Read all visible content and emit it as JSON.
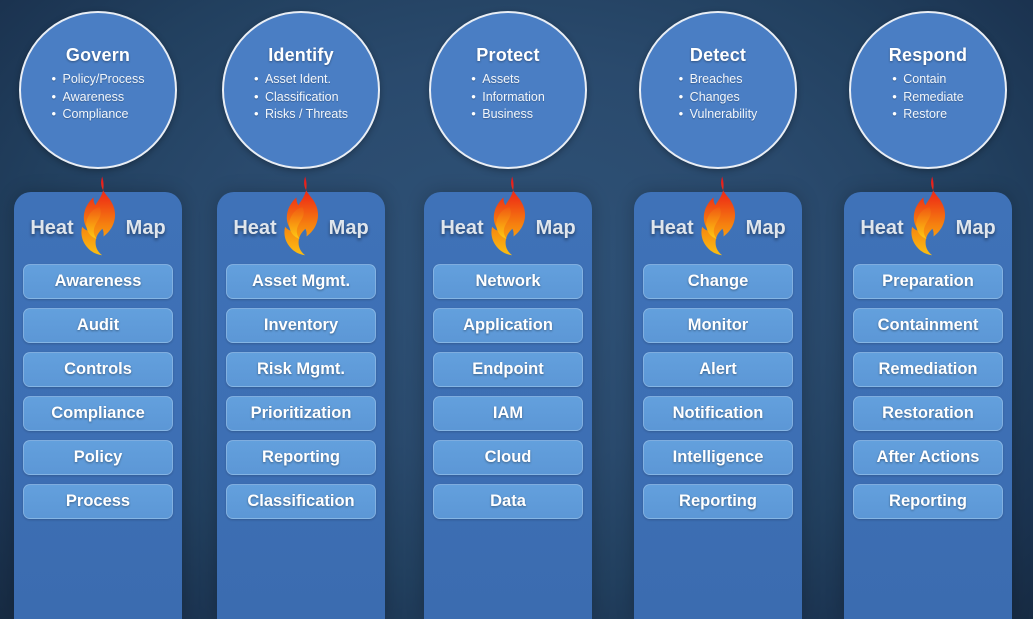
{
  "theme": {
    "background_dark": "#1b3350",
    "background_mid": "#2f5277",
    "circle_fill": "#4a7ec4",
    "circle_border": "#e9eef5",
    "panel_fill": "#3d6fb4",
    "item_fill": "#5c97d6",
    "item_text": "#ffffff",
    "heatmap_text": "#dfe5ec",
    "flame_top": "#e8202a",
    "flame_mid": "#f26a16",
    "flame_bottom": "#f9b814"
  },
  "heatmap": {
    "label_left": "Heat",
    "label_right": "Map",
    "icon": "flame-icon"
  },
  "columns": [
    {
      "id": "govern",
      "title": "Govern",
      "bullets": [
        "Policy/Process",
        "Awareness",
        "Compliance"
      ],
      "items": [
        "Awareness",
        "Audit",
        "Controls",
        "Compliance",
        "Policy",
        "Process"
      ]
    },
    {
      "id": "identify",
      "title": "Identify",
      "bullets": [
        "Asset Ident.",
        "Classification",
        "Risks / Threats"
      ],
      "items": [
        "Asset Mgmt.",
        "Inventory",
        "Risk Mgmt.",
        "Prioritization",
        "Reporting",
        "Classification"
      ]
    },
    {
      "id": "protect",
      "title": "Protect",
      "bullets": [
        "Assets",
        "Information",
        "Business"
      ],
      "items": [
        "Network",
        "Application",
        "Endpoint",
        "IAM",
        "Cloud",
        "Data"
      ]
    },
    {
      "id": "detect",
      "title": "Detect",
      "bullets": [
        "Breaches",
        "Changes",
        "Vulnerability"
      ],
      "items": [
        "Change",
        "Monitor",
        "Alert",
        "Notification",
        "Intelligence",
        "Reporting"
      ]
    },
    {
      "id": "respond",
      "title": "Respond",
      "bullets": [
        "Contain",
        "Remediate",
        "Restore"
      ],
      "items": [
        "Preparation",
        "Containment",
        "Remediation",
        "Restoration",
        "After Actions",
        "Reporting"
      ]
    }
  ]
}
